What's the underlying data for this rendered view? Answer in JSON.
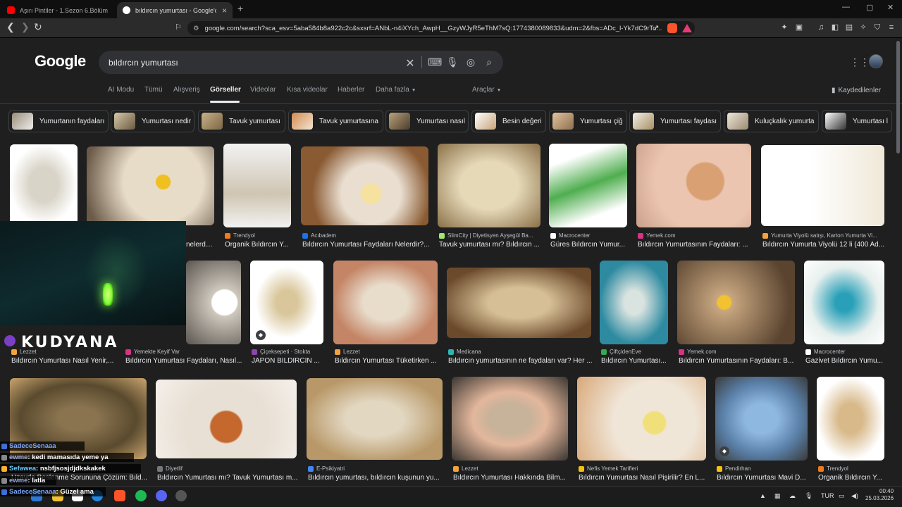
{
  "browser": {
    "tabs": [
      {
        "title": "Aşırı Pintiler - 1.Sezon 6.Bölüm - YouTube",
        "active": false
      },
      {
        "title": "bıldırcın yumurtası - Google'da Ara",
        "active": true
      }
    ],
    "new_tab": "+",
    "url": "google.com/search?sca_esv=5aba584b8a922c2c&sxsrf=ANbL-n4iXYch_AwpH__GzyWJyR5eThM7sQ:1774380089833&udm=2&fbs=ADc_l-Yk7dC9rTo..."
  },
  "google": {
    "logo": "Google",
    "query": "bıldırcın yumurtası",
    "tabs": [
      "AI Modu",
      "Tümü",
      "Alışveriş",
      "Görseller",
      "Videolar",
      "Kısa videolar",
      "Haberler",
      "Daha fazla"
    ],
    "selected_tab": "Görseller",
    "tools": "Araçlar",
    "saved": "Kaydedilenler",
    "chips": [
      "Yumurtanın faydaları",
      "Yumurtası nedir",
      "Tavuk yumurtası",
      "Tavuk yumurtasına",
      "Yumurtası nasıl",
      "Besin değeri",
      "Yumurtası çiğ",
      "Yumurtası faydası",
      "Kuluçkalık yumurta",
      "Yumurtası l"
    ],
    "results": [
      {
        "source": "",
        "caption": ""
      },
      {
        "source": "",
        "caption": "nelerdir?..."
      },
      {
        "source": "Trendyol",
        "caption": "Organik Bıldırcın Y..."
      },
      {
        "source": "Acıbadem",
        "caption": "Bıldırcın Yumurtası Faydaları Nelerdir?..."
      },
      {
        "source": "SlimCity | Diyetisyen Ayşegül Ba...",
        "caption": "Tavuk yumurtası mı? Bıldırcın ..."
      },
      {
        "source": "Macrocenter",
        "caption": "Güres Bıldırcın Yumur..."
      },
      {
        "source": "Yemek.com",
        "caption": "Bıldırcın Yumurtasının Faydaları: ..."
      },
      {
        "source": "Yumurta Viyolü satışı, Karton Yumurta Vi...",
        "caption": "Bıldırcın Yumurta Viyolü 12 li (400 Ad..."
      },
      {
        "source": "Lezzet",
        "caption": "Bıldırcın Yumurtası Nasıl Yenir,..."
      },
      {
        "source": "Yemekte Keyif Var",
        "caption": "Bıldırcın Yumurtası Faydaları, Nasıl..."
      },
      {
        "source": "Çiçeksepeti · Stokta",
        "caption": "JAPON BILDIRCIN ..."
      },
      {
        "source": "Lezzet",
        "caption": "Bıldırcın Yumurtası Tüketirken ..."
      },
      {
        "source": "Medicana",
        "caption": "Bıldırcın yumurtasının ne faydaları var? Her ..."
      },
      {
        "source": "ÇiftçidenEve",
        "caption": "Bıldırcın Yumurtası..."
      },
      {
        "source": "Yemek.com",
        "caption": "Bıldırcın Yumurtasının Faydaları: B..."
      },
      {
        "source": "Macrocenter",
        "caption": "Gazivet Bıldırcın Yumu..."
      },
      {
        "source": "",
        "caption": "Uzayda Beslenme Sorununa Çözüm: Bıld..."
      },
      {
        "source": "Diyetlif",
        "caption": "Bıldırcın Yumurtası mı? Tavuk Yumurtası m..."
      },
      {
        "source": "E-Psikiyatri",
        "caption": "Bıldırcın yumurtası, bıldırcın kuşunun yu..."
      },
      {
        "source": "Lezzet",
        "caption": "Bıldırcın Yumurtası Hakkında Bilm..."
      },
      {
        "source": "Nefis Yemek Tarifleri",
        "caption": "Bıldırcın Yumurtası Nasıl Pişirilir? En L..."
      },
      {
        "source": "Pendirhan",
        "caption": "Bıldırcın Yumurtası Mavi D..."
      },
      {
        "source": "Trendyol",
        "caption": "Organik Bıldırcın Y..."
      }
    ]
  },
  "overlay": {
    "watermark": "KUDYANA",
    "chat": [
      {
        "user": "SadeceSenaaa",
        "message": ""
      },
      {
        "user": "ewme",
        "message": ": kedi mamasıda yeme ya"
      },
      {
        "user": "Sefawea",
        "message": ": nsbfjsosjdjdkskakek"
      },
      {
        "user": "ewme",
        "message": ": latla"
      },
      {
        "user": "SadeceSenaaa",
        "message": ": Güzel ama"
      }
    ]
  },
  "taskbar": {
    "lang": "TUR",
    "time": "00:40",
    "date": "25.03.2026"
  }
}
